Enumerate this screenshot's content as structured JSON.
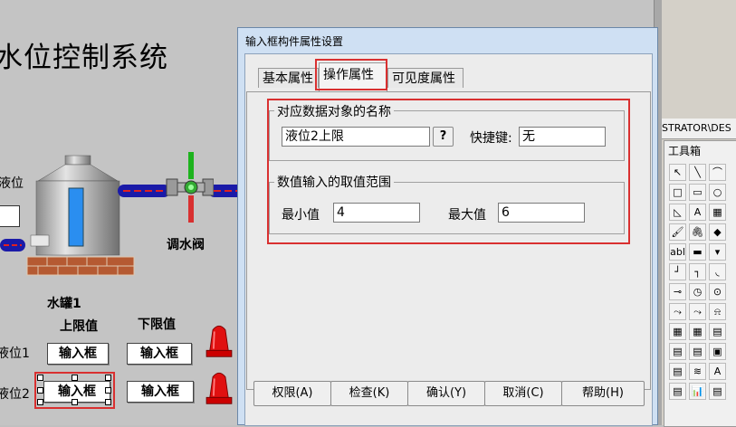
{
  "canvas": {
    "title": "水位控制系统",
    "level_label": "液位",
    "valve_label": "调水阀",
    "tank_label": "水罐1",
    "col_upper": "上限值",
    "col_lower": "下限值",
    "row1_label": "液位1",
    "row2_label": "液位2",
    "input_box_text": "输入框"
  },
  "right_panel": {
    "path_text": "STRATOR\\DES",
    "toolbox_title": "工具箱",
    "tools": [
      "pointer",
      "line",
      "arc",
      "rectangle",
      "rounded-rect",
      "ellipse",
      "polygon",
      "text",
      "image",
      "bitmap",
      "pipe",
      "fill",
      "label",
      "button",
      "dropdown",
      "line-2",
      "connector",
      "rotate",
      "knob",
      "dial",
      "flow",
      "chart",
      "chart-2",
      "alarm",
      "table",
      "table-2",
      "table-3",
      "report",
      "window",
      "record",
      "trend",
      "trend-2",
      "compose",
      "multi",
      "bars",
      "misc"
    ],
    "tool_glyphs": [
      "↖",
      "╲",
      "⌒",
      "□",
      "▭",
      "○",
      "◺",
      "A",
      "▦",
      "🖌",
      "🖇",
      "◆",
      "abl",
      "▬",
      "▾",
      "┘",
      "┐",
      "◟",
      "⊸",
      "◷",
      "⊙",
      "⤳",
      "⤳",
      "⍾",
      "▦",
      "▦",
      "▤",
      "▤",
      "▤",
      "▣",
      "▤",
      "≋",
      "A",
      "▤",
      "📊",
      "▤"
    ]
  },
  "dialog": {
    "title": "输入框构件属性设置",
    "tabs": [
      "基本属性",
      "操作属性",
      "可见度属性"
    ],
    "active_tab": "操作属性",
    "group1_title": "对应数据对象的名称",
    "data_object": "液位2上限",
    "help_button": "?",
    "hotkey_label": "快捷键:",
    "hotkey_value": "无",
    "group2_title": "数值输入的取值范围",
    "min_label": "最小值",
    "min_value": "4",
    "max_label": "最大值",
    "max_value": "6",
    "buttons": {
      "permission": "权限(A)",
      "check": "检查(K)",
      "confirm": "确认(Y)",
      "cancel": "取消(C)",
      "help": "帮助(H)"
    }
  }
}
